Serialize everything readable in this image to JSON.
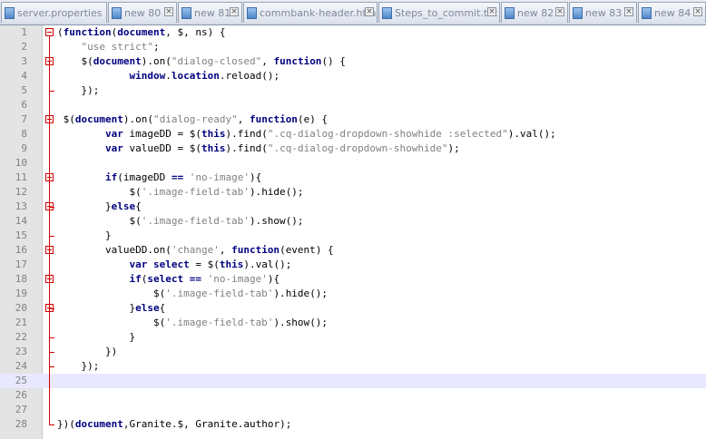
{
  "tabs": [
    {
      "label": "server.properties"
    },
    {
      "label": "new 80"
    },
    {
      "label": "new 81"
    },
    {
      "label": "commbank-header.html"
    },
    {
      "label": "Steps_to_commit.txt"
    },
    {
      "label": "new 82"
    },
    {
      "label": "new 83"
    },
    {
      "label": "new 84"
    }
  ],
  "editor": {
    "current_line": 25,
    "lines": [
      {
        "n": "1",
        "text": "(function(document, $, ns) {"
      },
      {
        "n": "2",
        "text": "    \"use strict\";"
      },
      {
        "n": "3",
        "text": "    $(document).on(\"dialog-closed\", function() {"
      },
      {
        "n": "4",
        "text": "            window.location.reload();"
      },
      {
        "n": "5",
        "text": "    });"
      },
      {
        "n": "6",
        "text": ""
      },
      {
        "n": "7",
        "text": " $(document).on(\"dialog-ready\", function(e) {"
      },
      {
        "n": "8",
        "text": "        var imageDD = $(this).find(\".cq-dialog-dropdown-showhide :selected\").val();"
      },
      {
        "n": "9",
        "text": "        var valueDD = $(this).find(\".cq-dialog-dropdown-showhide\");"
      },
      {
        "n": "10",
        "text": ""
      },
      {
        "n": "11",
        "text": "        if(imageDD == 'no-image'){"
      },
      {
        "n": "12",
        "text": "            $('.image-field-tab').hide();"
      },
      {
        "n": "13",
        "text": "        }else{"
      },
      {
        "n": "14",
        "text": "            $('.image-field-tab').show();"
      },
      {
        "n": "15",
        "text": "        }"
      },
      {
        "n": "16",
        "text": "        valueDD.on('change', function(event) {"
      },
      {
        "n": "17",
        "text": "            var select = $(this).val();"
      },
      {
        "n": "18",
        "text": "            if(select == 'no-image'){"
      },
      {
        "n": "19",
        "text": "                $('.image-field-tab').hide();"
      },
      {
        "n": "20",
        "text": "            }else{"
      },
      {
        "n": "21",
        "text": "                $('.image-field-tab').show();"
      },
      {
        "n": "22",
        "text": "            }"
      },
      {
        "n": "23",
        "text": "        })"
      },
      {
        "n": "24",
        "text": "    });"
      },
      {
        "n": "25",
        "text": ""
      },
      {
        "n": "26",
        "text": ""
      },
      {
        "n": "27",
        "text": ""
      },
      {
        "n": "28",
        "text": "})(document,Granite.$, Granite.author);"
      }
    ]
  },
  "colors": {
    "keyword": "#000080",
    "string": "#808080",
    "fold_marker": "#d40000",
    "current_line": "#e8e8ff",
    "gutter": "#e4e4e4"
  }
}
